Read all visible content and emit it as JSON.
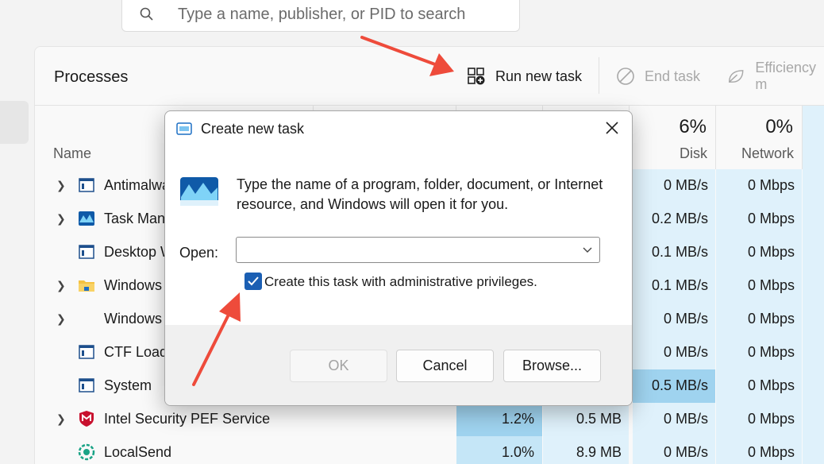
{
  "search": {
    "placeholder": "Type a name, publisher, or PID to search"
  },
  "panel": {
    "title": "Processes"
  },
  "toolbar": {
    "run_new_task": "Run new task",
    "end_task": "End task",
    "efficiency": "Efficiency m"
  },
  "columns": {
    "name": "Name",
    "disk_pct": "6%",
    "disk_label": "Disk",
    "network_pct": "0%",
    "network_label": "Network"
  },
  "processes": [
    {
      "name": "Antimalwa",
      "expandable": true,
      "icon": "window-icon",
      "cpu": "",
      "memory": "",
      "disk": "0 MB/s",
      "network": "0 Mbps"
    },
    {
      "name": "Task Mana",
      "expandable": true,
      "icon": "task-manager-icon",
      "cpu": "",
      "memory": "",
      "disk": "0.2 MB/s",
      "network": "0 Mbps"
    },
    {
      "name": "Desktop W",
      "expandable": false,
      "icon": "window-icon",
      "cpu": "",
      "memory": "",
      "disk": "0.1 MB/s",
      "network": "0 Mbps"
    },
    {
      "name": "Windows",
      "expandable": true,
      "icon": "folder-icon",
      "cpu": "",
      "memory": "",
      "disk": "0.1 MB/s",
      "network": "0 Mbps"
    },
    {
      "name": "Windows",
      "expandable": true,
      "icon": "blank-icon",
      "cpu": "",
      "memory": "",
      "disk": "0 MB/s",
      "network": "0 Mbps"
    },
    {
      "name": "CTF Loade",
      "expandable": false,
      "icon": "window-icon",
      "cpu": "",
      "memory": "",
      "disk": "0 MB/s",
      "network": "0 Mbps"
    },
    {
      "name": "System",
      "expandable": false,
      "icon": "window-icon",
      "cpu": "",
      "memory": "",
      "disk": "0.5 MB/s",
      "network": "0 Mbps"
    },
    {
      "name": "Intel Security PEF Service",
      "expandable": true,
      "icon": "mcafee-shield-icon",
      "cpu": "1.2%",
      "memory": "0.5 MB",
      "disk": "0 MB/s",
      "network": "0 Mbps"
    },
    {
      "name": "LocalSend",
      "expandable": false,
      "icon": "localsend-icon",
      "cpu": "1.0%",
      "memory": "8.9 MB",
      "disk": "0 MB/s",
      "network": "0 Mbps"
    }
  ],
  "dialog": {
    "title": "Create new task",
    "description": "Type the name of a program, folder, document, or Internet resource, and Windows will open it for you.",
    "open_label": "Open:",
    "open_value": "",
    "admin_checkbox_label": "Create this task with administrative privileges.",
    "admin_checked": true,
    "ok": "OK",
    "cancel": "Cancel",
    "browse": "Browse..."
  },
  "colors": {
    "heat_light": "#dff1fb",
    "heat_mid": "#c5e6f7",
    "heat_strong": "#9fd3ef",
    "accent": "#1b5fb3",
    "annotation_arrow": "#ee4b3b"
  }
}
